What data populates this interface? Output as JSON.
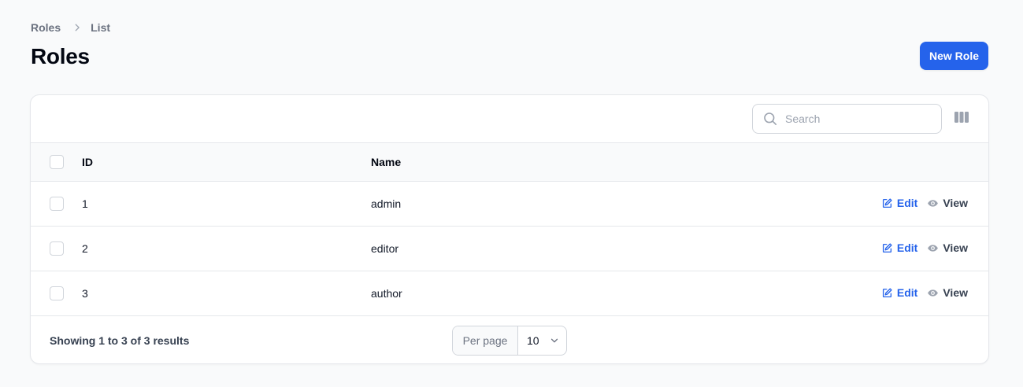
{
  "breadcrumb": {
    "items": [
      "Roles",
      "List"
    ]
  },
  "page": {
    "title": "Roles"
  },
  "header": {
    "new_label": "New Role"
  },
  "search": {
    "placeholder": "Search"
  },
  "table": {
    "columns": [
      "ID",
      "Name"
    ],
    "rows": [
      {
        "id": "1",
        "name": "admin"
      },
      {
        "id": "2",
        "name": "editor"
      },
      {
        "id": "3",
        "name": "author"
      }
    ],
    "actions": {
      "edit": "Edit",
      "view": "View"
    }
  },
  "footer": {
    "results": "Showing 1 to 3 of 3 results",
    "per_page_label": "Per page",
    "per_page_value": "10"
  },
  "colors": {
    "accent": "#2563eb",
    "border": "#e5e7eb",
    "muted": "#6b7280"
  },
  "icons": {
    "breadcrumb_sep": "chevron-right-icon",
    "search": "search-icon",
    "columns": "columns-icon",
    "edit": "edit-icon",
    "view": "eye-icon",
    "select": "chevron-down-icon"
  }
}
